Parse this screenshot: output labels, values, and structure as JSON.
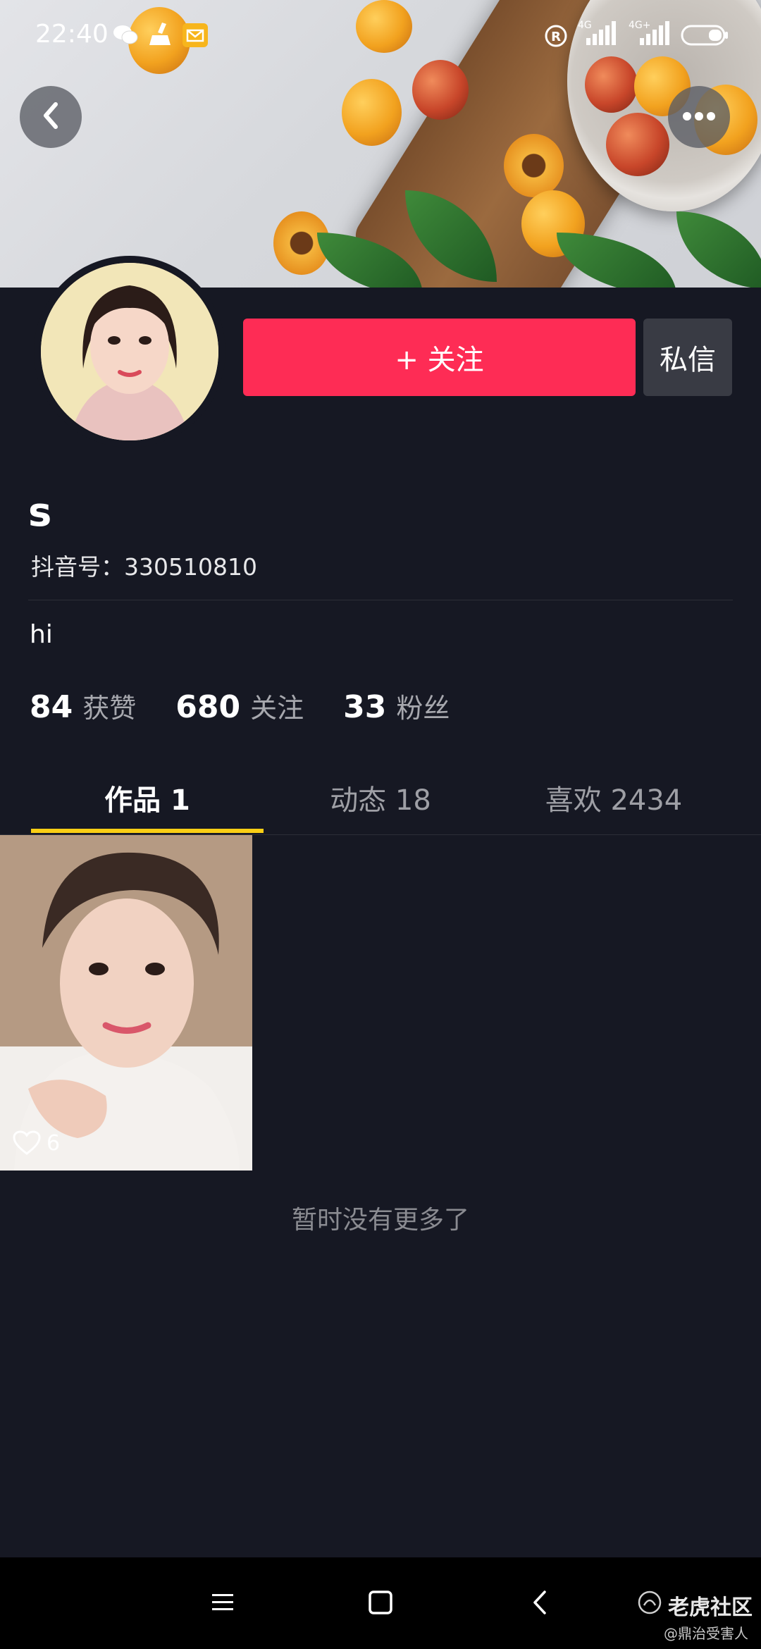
{
  "status_bar": {
    "time": "22:40",
    "left_icons": [
      "wechat-icon",
      "cleaner-icon",
      "mail-icon"
    ],
    "right_icons": [
      "registered-icon",
      "signal-4g-icon",
      "signal-4g-plus-icon",
      "battery-icon"
    ],
    "network_1": "4G",
    "network_2": "4G+"
  },
  "header": {
    "back_icon": "chevron-left-icon",
    "more_icon": "ellipsis-icon"
  },
  "profile": {
    "follow_label": "+ 关注",
    "message_label": "私信",
    "username": "s",
    "douyin_id": "抖音号：330510810",
    "bio": "hi"
  },
  "stats": {
    "likes_count": "84",
    "likes_label": "获赞",
    "following_count": "680",
    "following_label": "关注",
    "fans_count": "33",
    "fans_label": "粉丝"
  },
  "tabs": [
    {
      "label": "作品 1",
      "active": true
    },
    {
      "label": "动态 18",
      "active": false
    },
    {
      "label": "喜欢 2434",
      "active": false
    }
  ],
  "works": [
    {
      "likes": "6"
    }
  ],
  "footer_text": "暂时没有更多了",
  "nav": {
    "menu_icon": "menu-icon",
    "home_icon": "square-icon",
    "back_icon": "back-triangle-icon"
  },
  "watermark": {
    "line1": "老虎社区",
    "line2": "@鼎治受害人"
  },
  "colors": {
    "background": "#161823",
    "follow_button": "#fe2c55",
    "tab_indicator": "#face15"
  }
}
